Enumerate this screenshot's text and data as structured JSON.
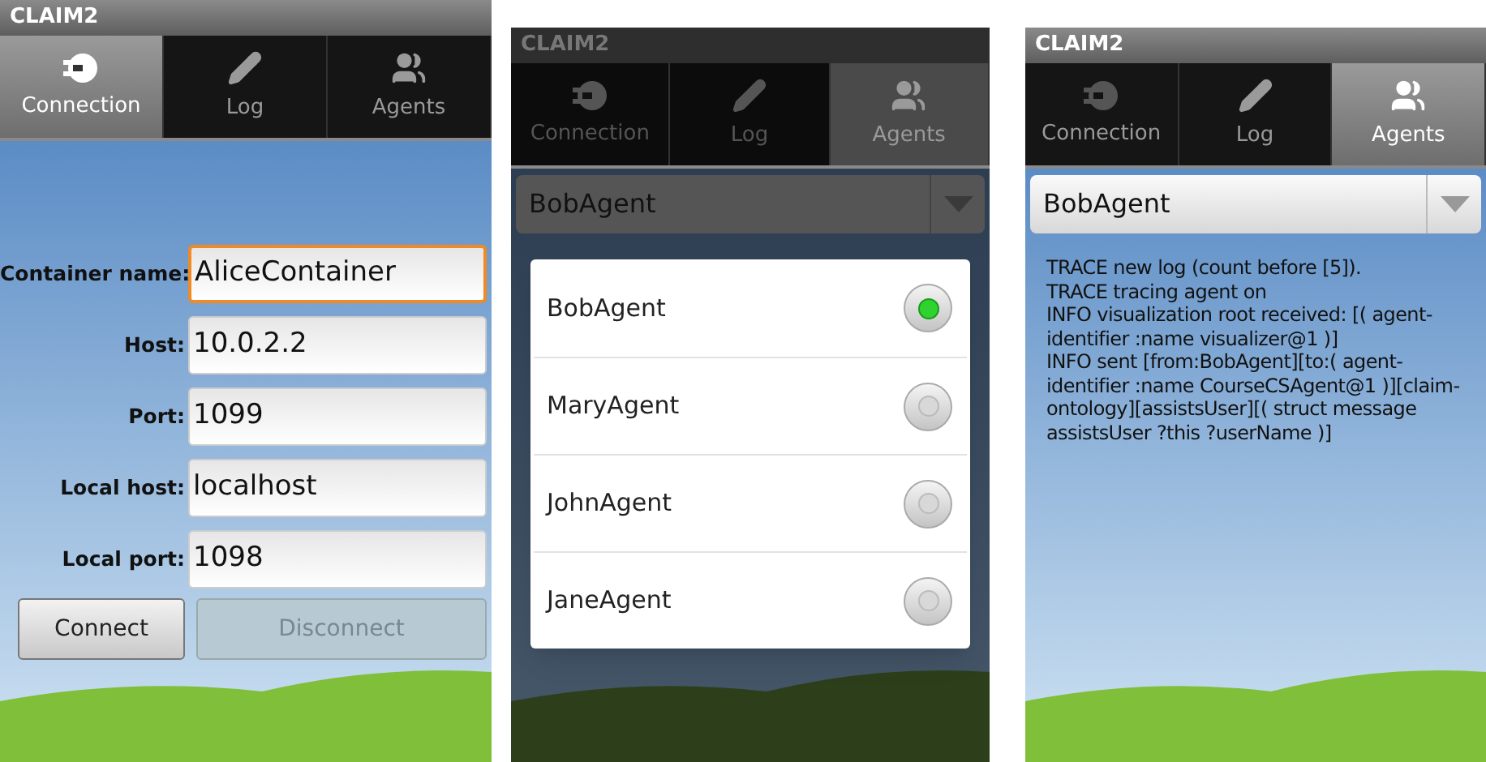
{
  "screens": [
    {
      "kind": "connection",
      "title": "CLAIM2",
      "dimmed": false,
      "tabs": [
        {
          "label": "Connection",
          "selected": true
        },
        {
          "label": "Log",
          "selected": false
        },
        {
          "label": "Agents",
          "selected": false
        }
      ],
      "fields": [
        {
          "label": "Container name:",
          "value": "AliceContainer",
          "focused": true
        },
        {
          "label": "Host:",
          "value": "10.0.2.2",
          "focused": false
        },
        {
          "label": "Port:",
          "value": "1099",
          "focused": false
        },
        {
          "label": "Local host:",
          "value": "localhost",
          "focused": false
        },
        {
          "label": "Local port:",
          "value": "1098",
          "focused": false
        }
      ],
      "buttons": [
        {
          "label": "Connect",
          "disabled": false
        },
        {
          "label": "Disconnect",
          "disabled": true
        }
      ]
    },
    {
      "kind": "agent_picker",
      "title": "CLAIM2",
      "dimmed": true,
      "tabs": [
        {
          "label": "Connection",
          "selected": false
        },
        {
          "label": "Log",
          "selected": false
        },
        {
          "label": "Agents",
          "selected": true
        }
      ],
      "dropdown": {
        "value": "BobAgent"
      },
      "options": [
        {
          "label": "BobAgent",
          "selected": true
        },
        {
          "label": "MaryAgent",
          "selected": false
        },
        {
          "label": "JohnAgent",
          "selected": false
        },
        {
          "label": "JaneAgent",
          "selected": false
        }
      ]
    },
    {
      "kind": "log",
      "title": "CLAIM2",
      "dimmed": false,
      "tabs": [
        {
          "label": "Connection",
          "selected": false
        },
        {
          "label": "Log",
          "selected": false
        },
        {
          "label": "Agents",
          "selected": true
        }
      ],
      "dropdown": {
        "value": "BobAgent"
      },
      "log_lines": [
        "TRACE new log (count before [5]).",
        "TRACE tracing agent on",
        "INFO visualization root received: [( agent-",
        "identifier :name visualizer@1 )]",
        "INFO sent [from:BobAgent][to:( agent-",
        "identifier :name CourseCSAgent@1 )][claim-",
        "ontology][assistsUser][( struct message",
        "assistsUser ?this ?userName )]"
      ]
    }
  ]
}
